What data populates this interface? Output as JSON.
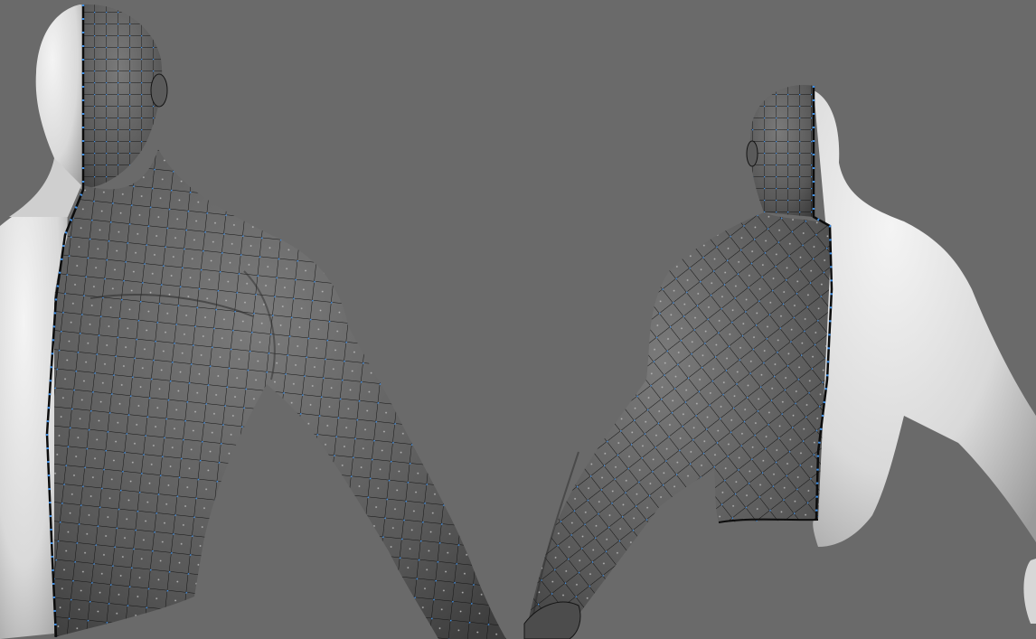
{
  "viewport": {
    "background_color": "#6a6a6a",
    "clay_color": "#e8e8e8",
    "mesh_fill_color": "#5c5c5c",
    "wire_color": "#121212",
    "vertex_color": "#3f8fe6",
    "face_dot_color": "#b8b8b8",
    "models": [
      {
        "view": "front",
        "overlay": "quad-wireframe-half"
      },
      {
        "view": "back",
        "overlay": "quad-wireframe-half"
      }
    ]
  }
}
